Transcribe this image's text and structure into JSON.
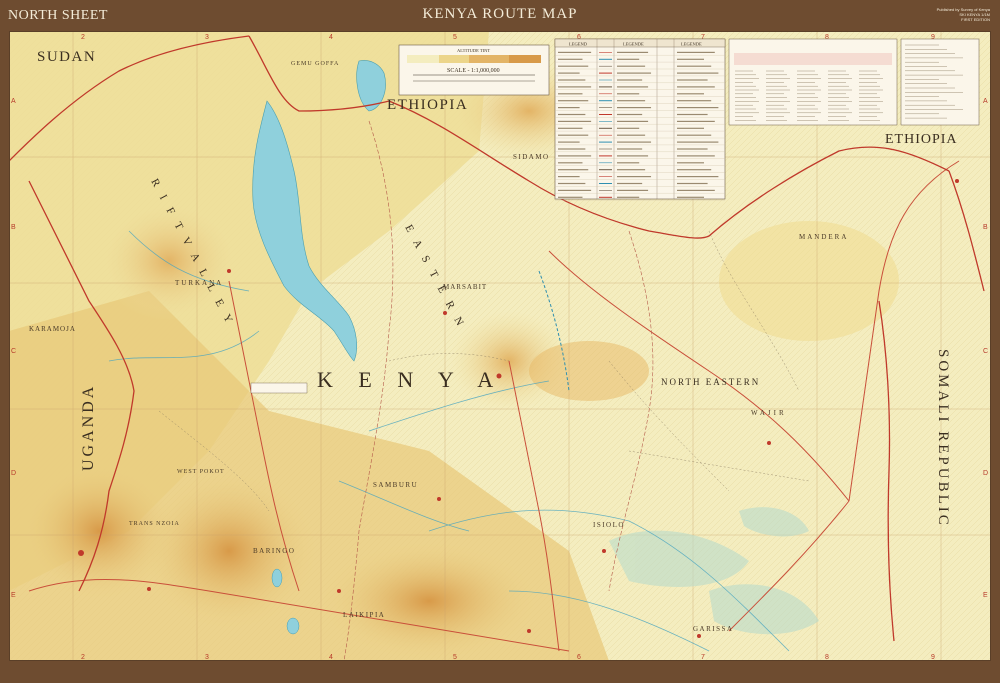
{
  "header": {
    "left_title": "NORTH SHEET",
    "center_title": "KENYA ROUTE MAP",
    "right_note_lines": [
      "Published by Survey of Kenya",
      "SKI KENYA 1/1M",
      "FIRST EDITION"
    ]
  },
  "grid": {
    "columns": [
      "2",
      "3",
      "4",
      "5",
      "6",
      "7",
      "8",
      "9"
    ],
    "rows": [
      "A",
      "B",
      "C",
      "D",
      "E"
    ]
  },
  "scale_box": {
    "altitude_title": "ALTITUDE TINT",
    "scale_label": "SCALE - 1:1,000,000"
  },
  "legend": {
    "headings": [
      "LEGEND",
      "LEGENDE",
      "LEGENDE"
    ],
    "rows": 22
  },
  "labels": {
    "countries": {
      "sudan": "SUDAN",
      "ethiopia_west": "ETHIOPIA",
      "ethiopia_east": "ETHIOPIA",
      "uganda": "UGANDA",
      "kenya": "K E N Y A",
      "somali": "SOMALI REPUBLIC"
    },
    "regions": {
      "turkana": "TURKANA",
      "karamoja": "KARAMOJA",
      "sidamo": "SIDAMO",
      "marsabit": "MARSABIT",
      "mandera": "MANDERA",
      "north_eastern": "NORTH EASTERN",
      "wajir": "WAJIR",
      "samburu": "SAMBURU",
      "west_pokot": "WEST POKOT",
      "trans_nzoia": "TRANS NZOIA",
      "baringo": "BARINGO",
      "laikipia": "LAIKIPIA",
      "isiolo": "ISIOLO",
      "garissa": "GARISSA",
      "gemu_goffa": "GEMU GOFFA",
      "eastern": "E A S T E R N",
      "rift_valley": "R I F T   V A L L E Y"
    }
  },
  "colors": {
    "frame": "#6e4c30",
    "lowland": "#f3ecb8",
    "midland": "#ecd58a",
    "highland": "#dfa955",
    "lake": "#8fd0dc",
    "boundary": "#c0392b",
    "road": "#c94f3a"
  }
}
